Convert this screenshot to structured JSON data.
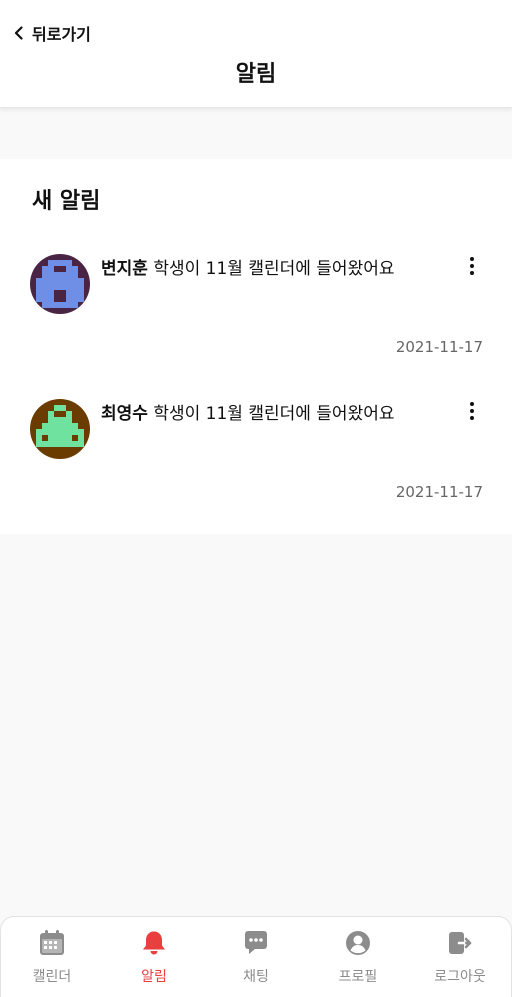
{
  "header": {
    "back_label": "뒤로가기",
    "title": "알림"
  },
  "section": {
    "title": "새 알림"
  },
  "notifications": [
    {
      "name": "변지훈",
      "message": " 학생이 11월 캘린더에 들어왔어요",
      "date": "2021-11-17",
      "avatar_bg": "#4a2444",
      "avatar_fg": "#6f8fe6"
    },
    {
      "name": "최영수",
      "message": " 학생이 11월 캘린더에 들어왔어요",
      "date": "2021-11-17",
      "avatar_bg": "#6b3c00",
      "avatar_fg": "#6fe2a0"
    }
  ],
  "tabbar": {
    "items": [
      {
        "label": "캘린더",
        "icon": "calendar-icon",
        "active": false
      },
      {
        "label": "알림",
        "icon": "bell-icon",
        "active": true
      },
      {
        "label": "채팅",
        "icon": "chat-icon",
        "active": false
      },
      {
        "label": "프로필",
        "icon": "profile-icon",
        "active": false
      },
      {
        "label": "로그아웃",
        "icon": "logout-icon",
        "active": false
      }
    ],
    "active_color": "#ea3f3f",
    "inactive_color": "#8c8c8c"
  }
}
